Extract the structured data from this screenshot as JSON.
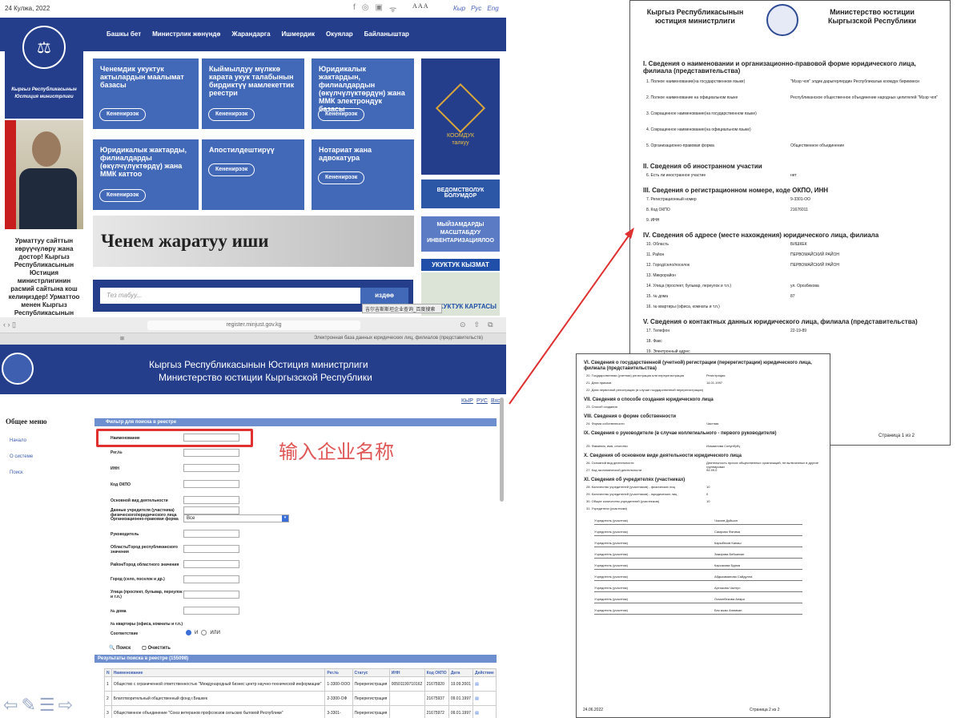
{
  "site": {
    "date": "24 Кулжа, 2022",
    "social": [
      "f",
      "◎",
      "▣",
      "ᯤ"
    ],
    "font_sizes": "A A A",
    "langs": [
      "Кыр",
      "Рус",
      "Eng"
    ],
    "nav": [
      "Башкы бет",
      "Министрлик жөнүндө",
      "Жарандарга",
      "Ишмердик",
      "Окуялар",
      "Байланыштар"
    ],
    "logo_caption": "Кыргыз Республикасынын Юстиция министрлиги",
    "greeting": "Урматтуу сайттын көрүүчүлөрү жана достор! Кыргыз Республикасынын Юстиция министрлигинин расмий сайтына кош келиңиздер! Урматтоо менен Кыргыз Республикасынын Юстиция министри Аяз",
    "more_label": "Кененирээк",
    "tiles": [
      "Ченемдик укуктук актылардын маалымат базасы",
      "Кыймылдуу мүлккө карата укук талабынын бирдиктүү мамлекеттик реестри",
      "Юридикалык жактардын, филиалдардын (өкүлчүлүктөрдүн) жана ММК электрондук базасы",
      "Юридикалык жактарды, филиалдарды (өкүлчүлүктөрдү) жана ММК каттоо",
      "Апостилдештирүү",
      "Нотариат жана адвокатура"
    ],
    "banner": "Ченем жаратуу иши",
    "search_placeholder": "Тез табуу...",
    "search_button": "издөө",
    "koomduk_title": "КООМДУК",
    "koomduk_sub": "талкуу",
    "right_banners": [
      "ВЕДОМСТВОЛУК БОЛУМДОР",
      "МЫЙЗАМДАРДЫ МАСШТАБДУУ ИНВЕНТАРИЗАЦИЯЛОО",
      "УКУКТУК КЫЗМАТ",
      "УКУКТУК КАРТАСЫ"
    ],
    "tooltip": "吉尔吉斯斯坦企业查询_百度搜索"
  },
  "browser": {
    "url": "register.minjust.gov.kg",
    "tab1": "⊞",
    "tab2": "Электронная база данных юридических лиц, филиалов (представительств)",
    "header_kg": "Кыргыз Республикасынын Юстиция министрлиги",
    "header_ru": "Министерство юстиции Кыргызской Республики",
    "langs": [
      "КЫР",
      "РУС",
      "Вход"
    ],
    "menu_title": "Общее меню",
    "menu": [
      "Начало",
      "О системе",
      "Поиск"
    ],
    "filter_title": "Фильтр для поиска в реестре",
    "fields": [
      "Наименование",
      "Рег.№",
      "ИНН",
      "Код ОКПО",
      "Основной вид деятельности",
      "Данные учредителя (участника) физического/юридического лица",
      "Организационно-правовая форма",
      "Руководитель",
      "Область/Город республиканского значения",
      "Район/Город областного значения",
      "Город (село, поселок и др.)",
      "Улица (проспект, бульвар, переулок и т.п.)",
      "№ дома",
      "№ квартиры (офиса, комнаты и т.п.)",
      "Соответствие"
    ],
    "select_value": "Все",
    "radio": [
      "И",
      "ИЛИ"
    ],
    "annotation": "输入企业名称",
    "search_btn": "Поиск",
    "clear_btn": "Очистить",
    "results_title": "Результаты поиска в реестре (155098)",
    "columns": [
      "N",
      "Наименование",
      "Рег.№",
      "Статус",
      "ИНН",
      "Код ОКПО",
      "Дата",
      "Действие"
    ],
    "rows": [
      [
        "1",
        "Общество с ограниченной ответственностью \"Международный бизнес центр научно-технической информации\"",
        "1-3300-ООО",
        "Перерегистрация",
        "00501199710162",
        "21675920",
        "19.09.2001",
        "▤"
      ],
      [
        "2",
        "Благотворительный общественный фонд г.Бишкек",
        "2-3300-ОФ",
        "Перерегистрация",
        "",
        "21675937",
        "09.01.1997",
        "▤"
      ],
      [
        "3",
        "Общественное объединение \"Союз ветеранов профсоюзов сельских бытовой Республики\"",
        "3-3301-",
        "Перерегистрация",
        "",
        "21675972",
        "09.01.1997",
        "▤"
      ]
    ]
  },
  "doc1": {
    "header_kg": "Кыргыз Республикасынын юстиция министрлиги",
    "header_ru": "Министерство юстиции Кыргызской Республики",
    "sections": [
      {
        "title": "I. Сведения о наименовании и организационно-правовой форме юридического лица, филиала (представительства)",
        "rows": [
          [
            "1. Полное наименование(на государственном языке)",
            "\"Мээр чоп\" элдик дарыгерлердин Республикалык коомдук бирикмеси"
          ],
          [
            "2. Полное наименование на официальном языке",
            "Республиканское общественное объединение народных целителей \"Мээр чоп\""
          ],
          [
            "3. Сокращенное наименование(на государственном языке)",
            ""
          ],
          [
            "4. Сокращенное наименование(на официальном языке)",
            ""
          ],
          [
            "5. Организационно-правовая форма",
            "Общественное объединение"
          ]
        ]
      },
      {
        "title": "II. Сведения об иностранном участии",
        "rows": [
          [
            "6. Есть ли иностранное участие",
            "нет"
          ]
        ]
      },
      {
        "title": "III. Сведения о регистрационном номере, коде ОКПО, ИНН",
        "rows": [
          [
            "7. Регистрационный номер",
            "9-3301-ОО"
          ],
          [
            "8. Код ОКПО",
            "21676011"
          ],
          [
            "9. ИНН",
            ""
          ]
        ]
      },
      {
        "title": "IV. Сведения об адресе (месте нахождения) юридического лица, филиала",
        "rows": [
          [
            "10. Область",
            "БИШКЕК"
          ],
          [
            "11. Район",
            "ПЕРВОМАЙСКИЙ РАЙОН"
          ],
          [
            "12. Город/село/поселок",
            "ПЕРВОМАЙСКИЙ РАЙОН"
          ],
          [
            "13. Микрорайон",
            ""
          ],
          [
            "14. Улица (проспект, бульвар, переулок и т.п.)",
            "ул. Орозбекова"
          ],
          [
            "15. № дома",
            "87"
          ],
          [
            "16. № квартиры (офиса, комнаты и т.п.)",
            ""
          ]
        ]
      },
      {
        "title": "V. Сведения о контактных данных юридического лица, филиала (представительства)",
        "rows": [
          [
            "17. Телефон",
            "22-19-89"
          ],
          [
            "18. Факс",
            ""
          ],
          [
            "19. Электронный адрес",
            ""
          ]
        ]
      }
    ],
    "page": "Страница 1 из 2"
  },
  "doc2": {
    "sections": [
      {
        "title": "VI. Сведения о государственной (учетной) регистрации (перерегистрации) юридического лица, филиала (представительства)",
        "rows": [
          [
            "20. Государственная (учетная) регистрация или перерегистрация",
            "Регистрация"
          ],
          [
            "21. Дата приказа",
            "14.01.1997"
          ],
          [
            "22. Дата первичной регистрации (в случае государственной перерегистрации)",
            ""
          ]
        ]
      },
      {
        "title": "VII. Сведения о способе создания юридического лица",
        "rows": [
          [
            "23. Способ создания",
            ""
          ]
        ]
      },
      {
        "title": "VIII. Сведения о форме собственности",
        "rows": [
          [
            "24. Форма собственности",
            "Частная"
          ]
        ]
      },
      {
        "title": "IX. Сведения о руководителе (в случае коллегиального - первого руководителя)",
        "rows": [
          [
            "25. Фамилия, имя, отчество",
            "Исмаилова Сонунбүбү"
          ]
        ]
      },
      {
        "title": "X. Сведения об основном виде деятельности юридического лица",
        "rows": [
          [
            "26. Основной вид деятельности",
            "Деятельность прочих общественных организаций, не включенных в другие группировки"
          ],
          [
            "27. Код экономической деятельности",
            "94.99.0"
          ]
        ]
      },
      {
        "title": "XI. Сведения об учредителях (участниках)",
        "rows": [
          [
            "28. Количество учредителей (участников) - физических лиц",
            "10"
          ],
          [
            "29. Количество учредителей (участников) - юридических лиц",
            "0"
          ],
          [
            "30. Общее количество учредителей (участников)",
            "10"
          ],
          [
            "31. Учредители (участники)",
            ""
          ]
        ]
      }
    ],
    "founder_label": "Учредитель (участник)",
    "founders": [
      "Чокоев Дуйшон",
      "Самрова Фатима",
      "Карыбеков Канаш",
      "Закирова Бейшекан",
      "Карсакова Бурма",
      "Абдыкаманова Сайдулла",
      "Артыкова Чынгул",
      "Осмонбекова Анара",
      "Бек кызы Алимкан"
    ],
    "date": "24.06.2022",
    "page": "Страница 2 из 2"
  },
  "colors": {
    "brand": "#243e8c",
    "tile": "#4268b8",
    "red": "#e03030",
    "annotation": "#e05555"
  }
}
